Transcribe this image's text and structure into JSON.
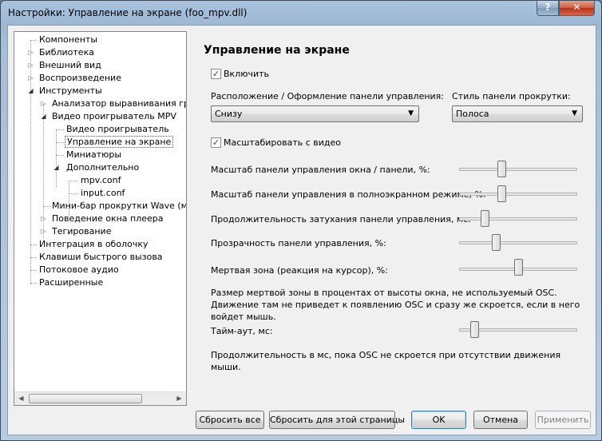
{
  "window": {
    "title": "Настройки: Управление на экране (foo_mpv.dll)",
    "help_label": "?",
    "close_label": "✕"
  },
  "tree": {
    "items": [
      {
        "label": "Компоненты"
      },
      {
        "label": "Библиотека"
      },
      {
        "label": "Внешний вид"
      },
      {
        "label": "Воспроизведение"
      },
      {
        "label": "Инструменты"
      },
      {
        "label": "Анализатор выравнивания громкос"
      },
      {
        "label": "Видео проигрыватель MPV"
      },
      {
        "label": "Видео проигрыватель"
      },
      {
        "label": "Управление на экране"
      },
      {
        "label": "Миниатюры"
      },
      {
        "label": "Дополнительно"
      },
      {
        "label": "mpv.conf"
      },
      {
        "label": "input.conf"
      },
      {
        "label": "Мини-бар прокрутки Wave (мод)"
      },
      {
        "label": "Поведение окна плеера"
      },
      {
        "label": "Тегирование"
      },
      {
        "label": "Интеграция в оболочку"
      },
      {
        "label": "Клавиши быстрого вызова"
      },
      {
        "label": "Потоковое аудио"
      },
      {
        "label": "Расширенные"
      }
    ]
  },
  "page": {
    "title": "Управление на экране",
    "enable_label": "Включить",
    "enable_checked": true,
    "position_label": "Расположение / Оформление панели управления:",
    "position_value": "Снизу",
    "scroll_style_label": "Стиль панели прокрутки:",
    "scroll_style_value": "Полоса",
    "scale_with_video_label": "Масштабировать с видео",
    "scale_with_video_checked": true,
    "sliders": [
      {
        "label": "Масштаб панели управления окна / панели, %:",
        "level": 0.35
      },
      {
        "label": "Масштаб панели управления в полноэкранном режиме, %:",
        "level": 0.35
      },
      {
        "label": "Продолжительность затухания панели управления, мс:",
        "level": 0.2
      },
      {
        "label": "Прозрачность панели управления, %:",
        "level": 0.3
      },
      {
        "label": "Мертвая зона (реакция на курсор), %:",
        "level": 0.5
      }
    ],
    "deadzone_desc": "Размер мертвой зоны в процентах от высоты окна, не используемый OSC. Движение там не приведет к появлению OSC и сразу же скроется, если в него войдет мышь.",
    "timeout_label": "Тайм-аут, мс:",
    "timeout_level": 0.1,
    "timeout_desc": "Продолжительность в мс, пока OSC не скроется при отсутствии движения мыши."
  },
  "buttons": {
    "reset_all": "Сбросить все",
    "reset_page": "Сбросить для этой страницы",
    "ok": "OK",
    "cancel": "Отмена",
    "apply": "Применить"
  }
}
